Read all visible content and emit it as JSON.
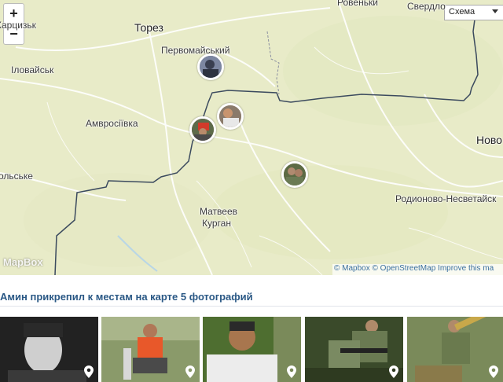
{
  "map": {
    "zoom_in_label": "+",
    "zoom_out_label": "−",
    "layer_select_value": "Схема",
    "cities": {
      "torez": "Торез",
      "pervomaiskiy": "Первомайський",
      "ilovaisk": "Іловайськ",
      "khartsyzk": "Харцизьк",
      "amvrosiivka": "Амвросіївка",
      "olske": "ольське",
      "matveev": "Матвеев",
      "kurgan": "Курган",
      "rovenki": "Ровеньки",
      "sverdlovsk": "Свердло",
      "novo": "Ново",
      "rodionovo": "Родионово-Несветайск"
    },
    "logo": "MapBox",
    "attribution": {
      "mapbox": "© Mapbox",
      "osm": "© OpenStreetMap",
      "improve": "Improve this ma"
    },
    "colors": {
      "land": "#e9ecc9",
      "border": "#3b4a5e",
      "road": "#ffffff"
    },
    "photo_pins": [
      "photo-pin-1",
      "photo-pin-2",
      "photo-pin-3",
      "photo-pin-4"
    ]
  },
  "caption": "Амин прикрепил к местам на карте 5 фотографий",
  "thumbnails": [
    {
      "name": "thumb-1"
    },
    {
      "name": "thumb-2"
    },
    {
      "name": "thumb-3"
    },
    {
      "name": "thumb-4"
    },
    {
      "name": "thumb-5"
    }
  ]
}
